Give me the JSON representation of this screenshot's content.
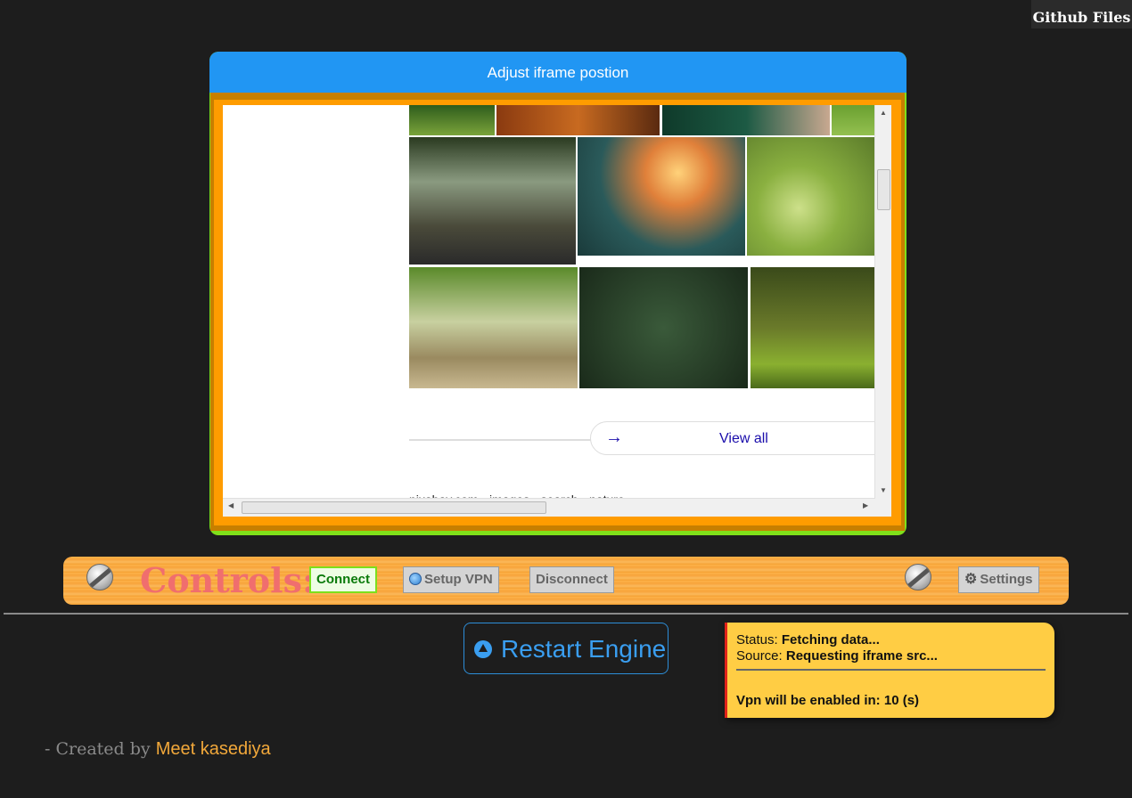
{
  "header_link": {
    "label": "Github Files"
  },
  "frame_panel": {
    "title": "Adjust iframe postion",
    "iframe": {
      "view_all_label": "View all",
      "cut_text": "pixabay.com · images · search · nature"
    }
  },
  "controls": {
    "title": "Controls:",
    "connect_label": "Connect",
    "setup_vpn_label": "Setup VPN",
    "disconnect_label": "Disconnect",
    "settings_label": "Settings"
  },
  "restart": {
    "label": "Restart Engine"
  },
  "status_box": {
    "status_key": "Status:",
    "status_value": "Fetching data...",
    "source_key": "Source:",
    "source_value": "Requesting iframe src...",
    "vpn_text": "Vpn will be enabled in: 10 (s)"
  },
  "credit": {
    "prefix": "- Created by",
    "name": "Meet kasediya"
  },
  "colors": {
    "background": "#1d1d1d",
    "frame_header": "#2196f3",
    "frame_border_outer": "#7fe01a",
    "frame_border_mid": "#c77f00",
    "frame_border_inner": "#ff9c00",
    "controls_bar": "#f7a43b",
    "restart_accent": "#3a9ef0",
    "status_box": "#ffcd44",
    "status_stripe": "#e0221a",
    "credit_name": "#f2a83a"
  },
  "icons": [
    "screw-icon",
    "globe-icon",
    "gear-icon",
    "restart-icon",
    "arrow-right-icon"
  ]
}
